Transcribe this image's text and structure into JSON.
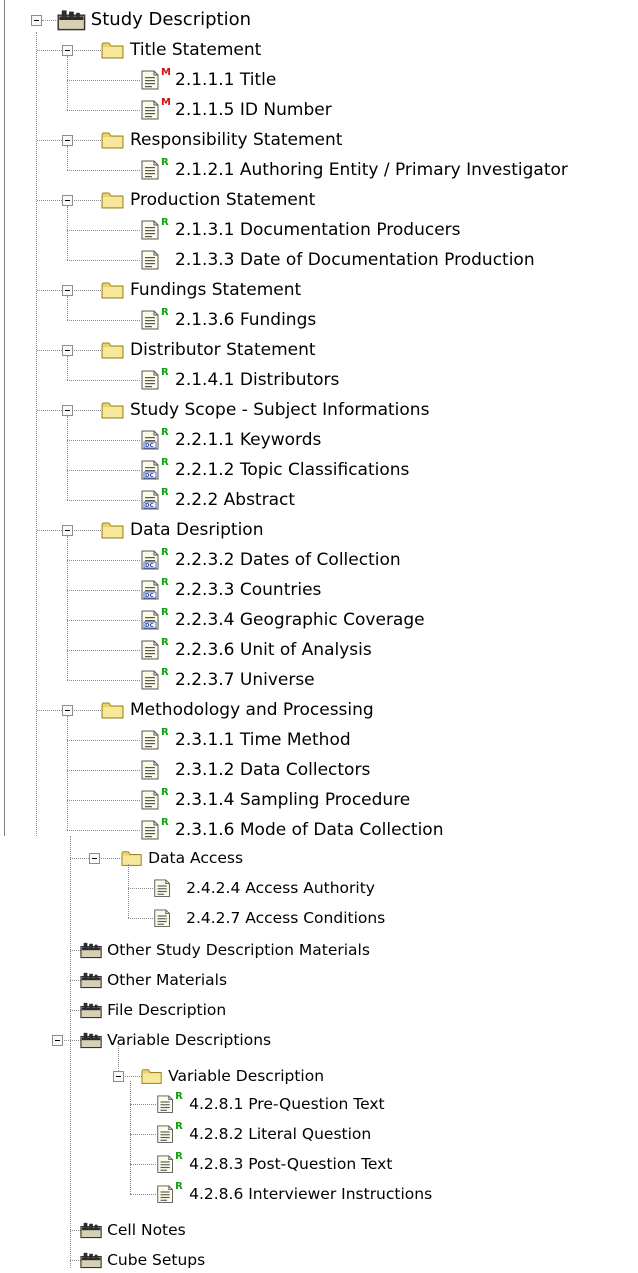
{
  "colors": {
    "mandatory_marker": "#d01010",
    "recommended_marker": "#10a010"
  },
  "tree": {
    "root": {
      "label": "Study Description",
      "icon": "folder-tab-icon",
      "groups": [
        {
          "label": "Title Statement",
          "icon": "folder-icon",
          "items": [
            {
              "label": "2.1.1.1  Title",
              "icon": "document-icon",
              "marker": "M"
            },
            {
              "label": "2.1.1.5  ID Number",
              "icon": "document-icon",
              "marker": "M"
            }
          ]
        },
        {
          "label": "Responsibility Statement",
          "icon": "folder-icon",
          "items": [
            {
              "label": "2.1.2.1  Authoring Entity / Primary Investigator",
              "icon": "document-icon",
              "marker": "R"
            }
          ]
        },
        {
          "label": "Production Statement",
          "icon": "folder-icon",
          "items": [
            {
              "label": "2.1.3.1  Documentation Producers",
              "icon": "document-icon",
              "marker": "R"
            },
            {
              "label": "2.1.3.3  Date of Documentation Production",
              "icon": "document-icon",
              "marker": ""
            }
          ]
        },
        {
          "label": "Fundings Statement",
          "icon": "folder-icon",
          "items": [
            {
              "label": "2.1.3.6  Fundings",
              "icon": "document-icon",
              "marker": "R"
            }
          ]
        },
        {
          "label": "Distributor Statement",
          "icon": "folder-icon",
          "items": [
            {
              "label": "2.1.4.1  Distributors",
              "icon": "document-icon",
              "marker": "R"
            }
          ]
        },
        {
          "label": "Study Scope - Subject Informations",
          "icon": "folder-icon",
          "items": [
            {
              "label": "2.2.1.1  Keywords",
              "icon": "dc-document-icon",
              "marker": "R"
            },
            {
              "label": "2.2.1.2  Topic Classifications",
              "icon": "dc-document-icon",
              "marker": "R"
            },
            {
              "label": "2.2.2  Abstract",
              "icon": "dc-document-icon",
              "marker": "R"
            }
          ]
        },
        {
          "label": "Data Desription",
          "icon": "folder-icon",
          "items": [
            {
              "label": "2.2.3.2  Dates of Collection",
              "icon": "dc-document-icon",
              "marker": "R"
            },
            {
              "label": "2.2.3.3  Countries",
              "icon": "dc-document-icon",
              "marker": "R"
            },
            {
              "label": "2.2.3.4  Geographic Coverage",
              "icon": "dc-document-icon",
              "marker": "R"
            },
            {
              "label": "2.2.3.6  Unit of Analysis",
              "icon": "document-icon",
              "marker": "R"
            },
            {
              "label": "2.2.3.7  Universe",
              "icon": "document-icon",
              "marker": "R"
            }
          ]
        },
        {
          "label": "Methodology and Processing",
          "icon": "folder-icon",
          "items": [
            {
              "label": "2.3.1.1  Time Method",
              "icon": "document-icon",
              "marker": "R"
            },
            {
              "label": "2.3.1.2  Data Collectors",
              "icon": "document-icon",
              "marker": ""
            },
            {
              "label": "2.3.1.4  Sampling Procedure",
              "icon": "document-icon",
              "marker": "R"
            },
            {
              "label": "2.3.1.6  Mode of Data Collection",
              "icon": "document-icon",
              "marker": "R"
            }
          ]
        }
      ]
    },
    "lower": {
      "data_access": {
        "label": "Data Access",
        "icon": "folder-icon",
        "items": [
          {
            "label": "2.4.2.4  Access Authority",
            "icon": "document-icon",
            "marker": ""
          },
          {
            "label": "2.4.2.7  Access Conditions",
            "icon": "document-icon",
            "marker": ""
          }
        ]
      },
      "siblings": [
        {
          "label": "Other Study Description Materials",
          "icon": "folder-tab-icon"
        },
        {
          "label": "Other Materials",
          "icon": "folder-tab-icon"
        },
        {
          "label": "File Description",
          "icon": "folder-tab-icon"
        }
      ],
      "variable_descriptions": {
        "label": "Variable Descriptions",
        "icon": "folder-tab-icon",
        "child": {
          "label": "Variable Description",
          "icon": "folder-icon",
          "items": [
            {
              "label": "4.2.8.1  Pre-Question Text",
              "icon": "document-icon",
              "marker": "R"
            },
            {
              "label": "4.2.8.2  Literal Question",
              "icon": "document-icon",
              "marker": "R"
            },
            {
              "label": "4.2.8.3  Post-Question Text",
              "icon": "document-icon",
              "marker": "R"
            },
            {
              "label": "4.2.8.6  Interviewer Instructions",
              "icon": "document-icon",
              "marker": "R"
            }
          ]
        }
      },
      "tail": [
        {
          "label": "Cell Notes",
          "icon": "folder-tab-icon"
        },
        {
          "label": "Cube Setups",
          "icon": "folder-tab-icon"
        }
      ]
    }
  }
}
